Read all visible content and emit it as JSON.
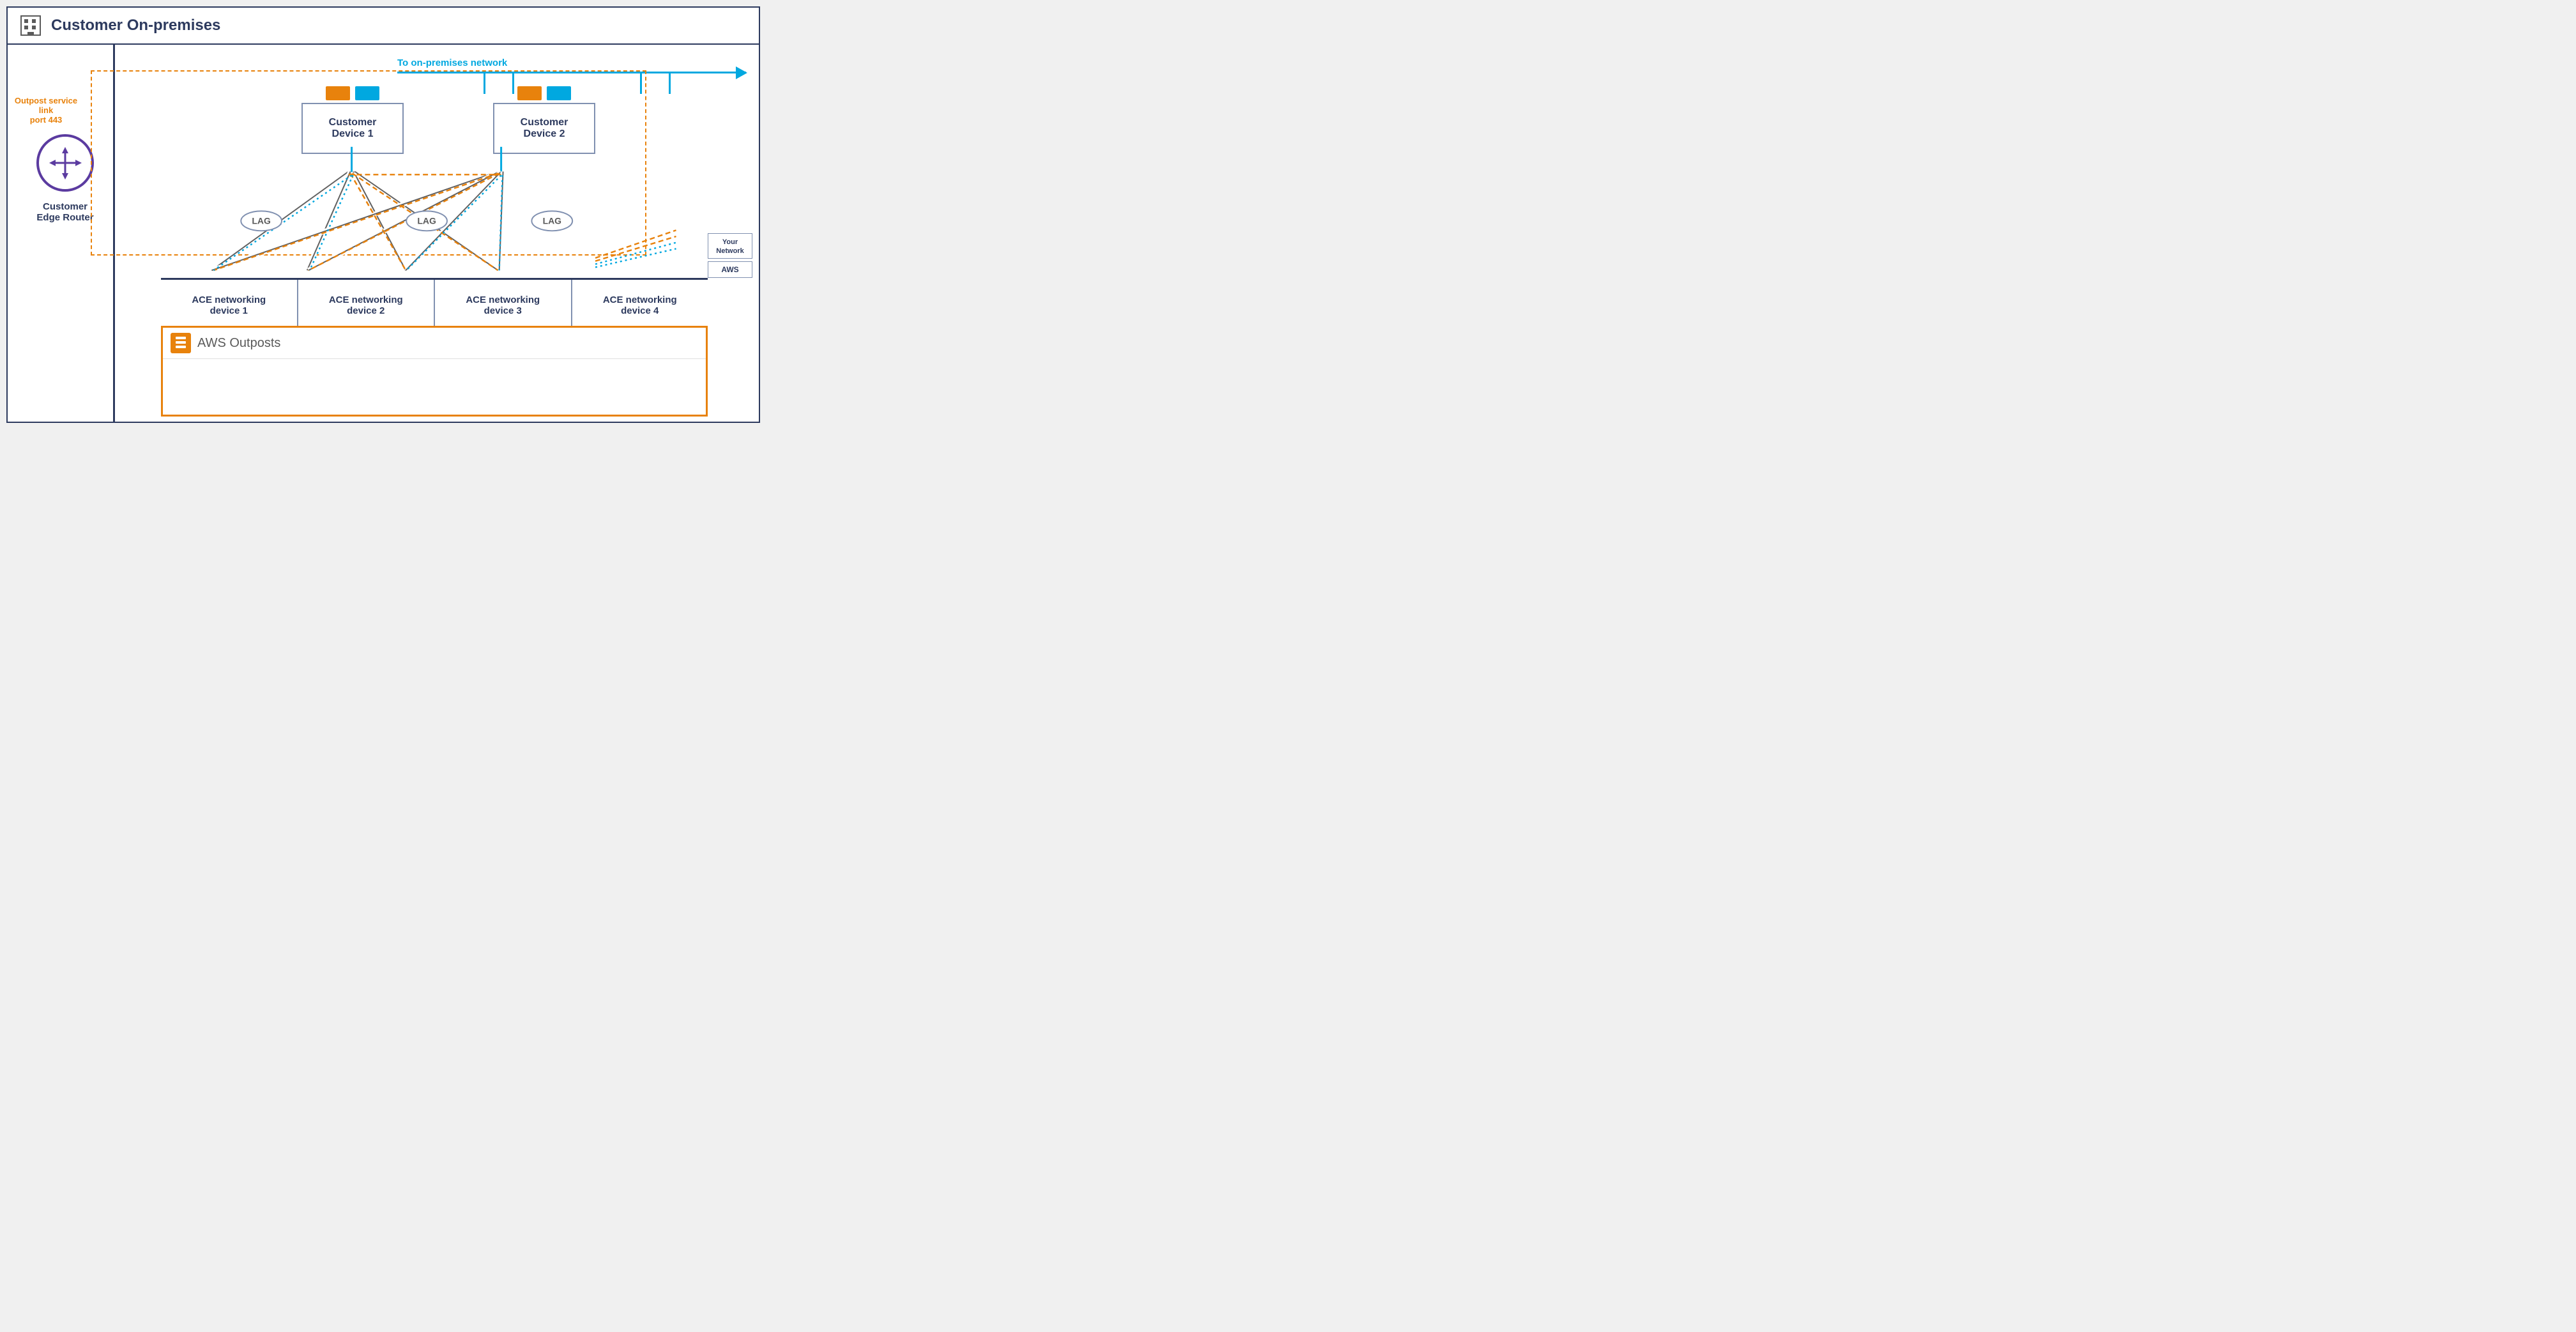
{
  "diagram": {
    "title": "Customer On-premises",
    "header_icon": "building",
    "onprem_arrow_label": "To on-premises network",
    "service_link_label": "Outpost service link\nport 443",
    "router_label": "Customer\nEdge Router",
    "customer_devices": [
      {
        "label": "Customer\nDevice 1"
      },
      {
        "label": "Customer\nDevice 2"
      }
    ],
    "lag_labels": [
      "LAG",
      "LAG",
      "LAG"
    ],
    "ace_devices": [
      {
        "label": "ACE networking\ndevice 1"
      },
      {
        "label": "ACE networking\ndevice 2"
      },
      {
        "label": "ACE networking\ndevice 3"
      },
      {
        "label": "ACE networking\ndevice 4"
      }
    ],
    "outposts_title": "AWS Outposts",
    "right_labels": [
      "Your\nNetwork",
      "AWS"
    ],
    "colors": {
      "orange": "#e8820c",
      "cyan": "#00a8e0",
      "dark_blue": "#2d3a5e",
      "purple": "#5b3ba0",
      "light_border": "#8090b0"
    }
  }
}
